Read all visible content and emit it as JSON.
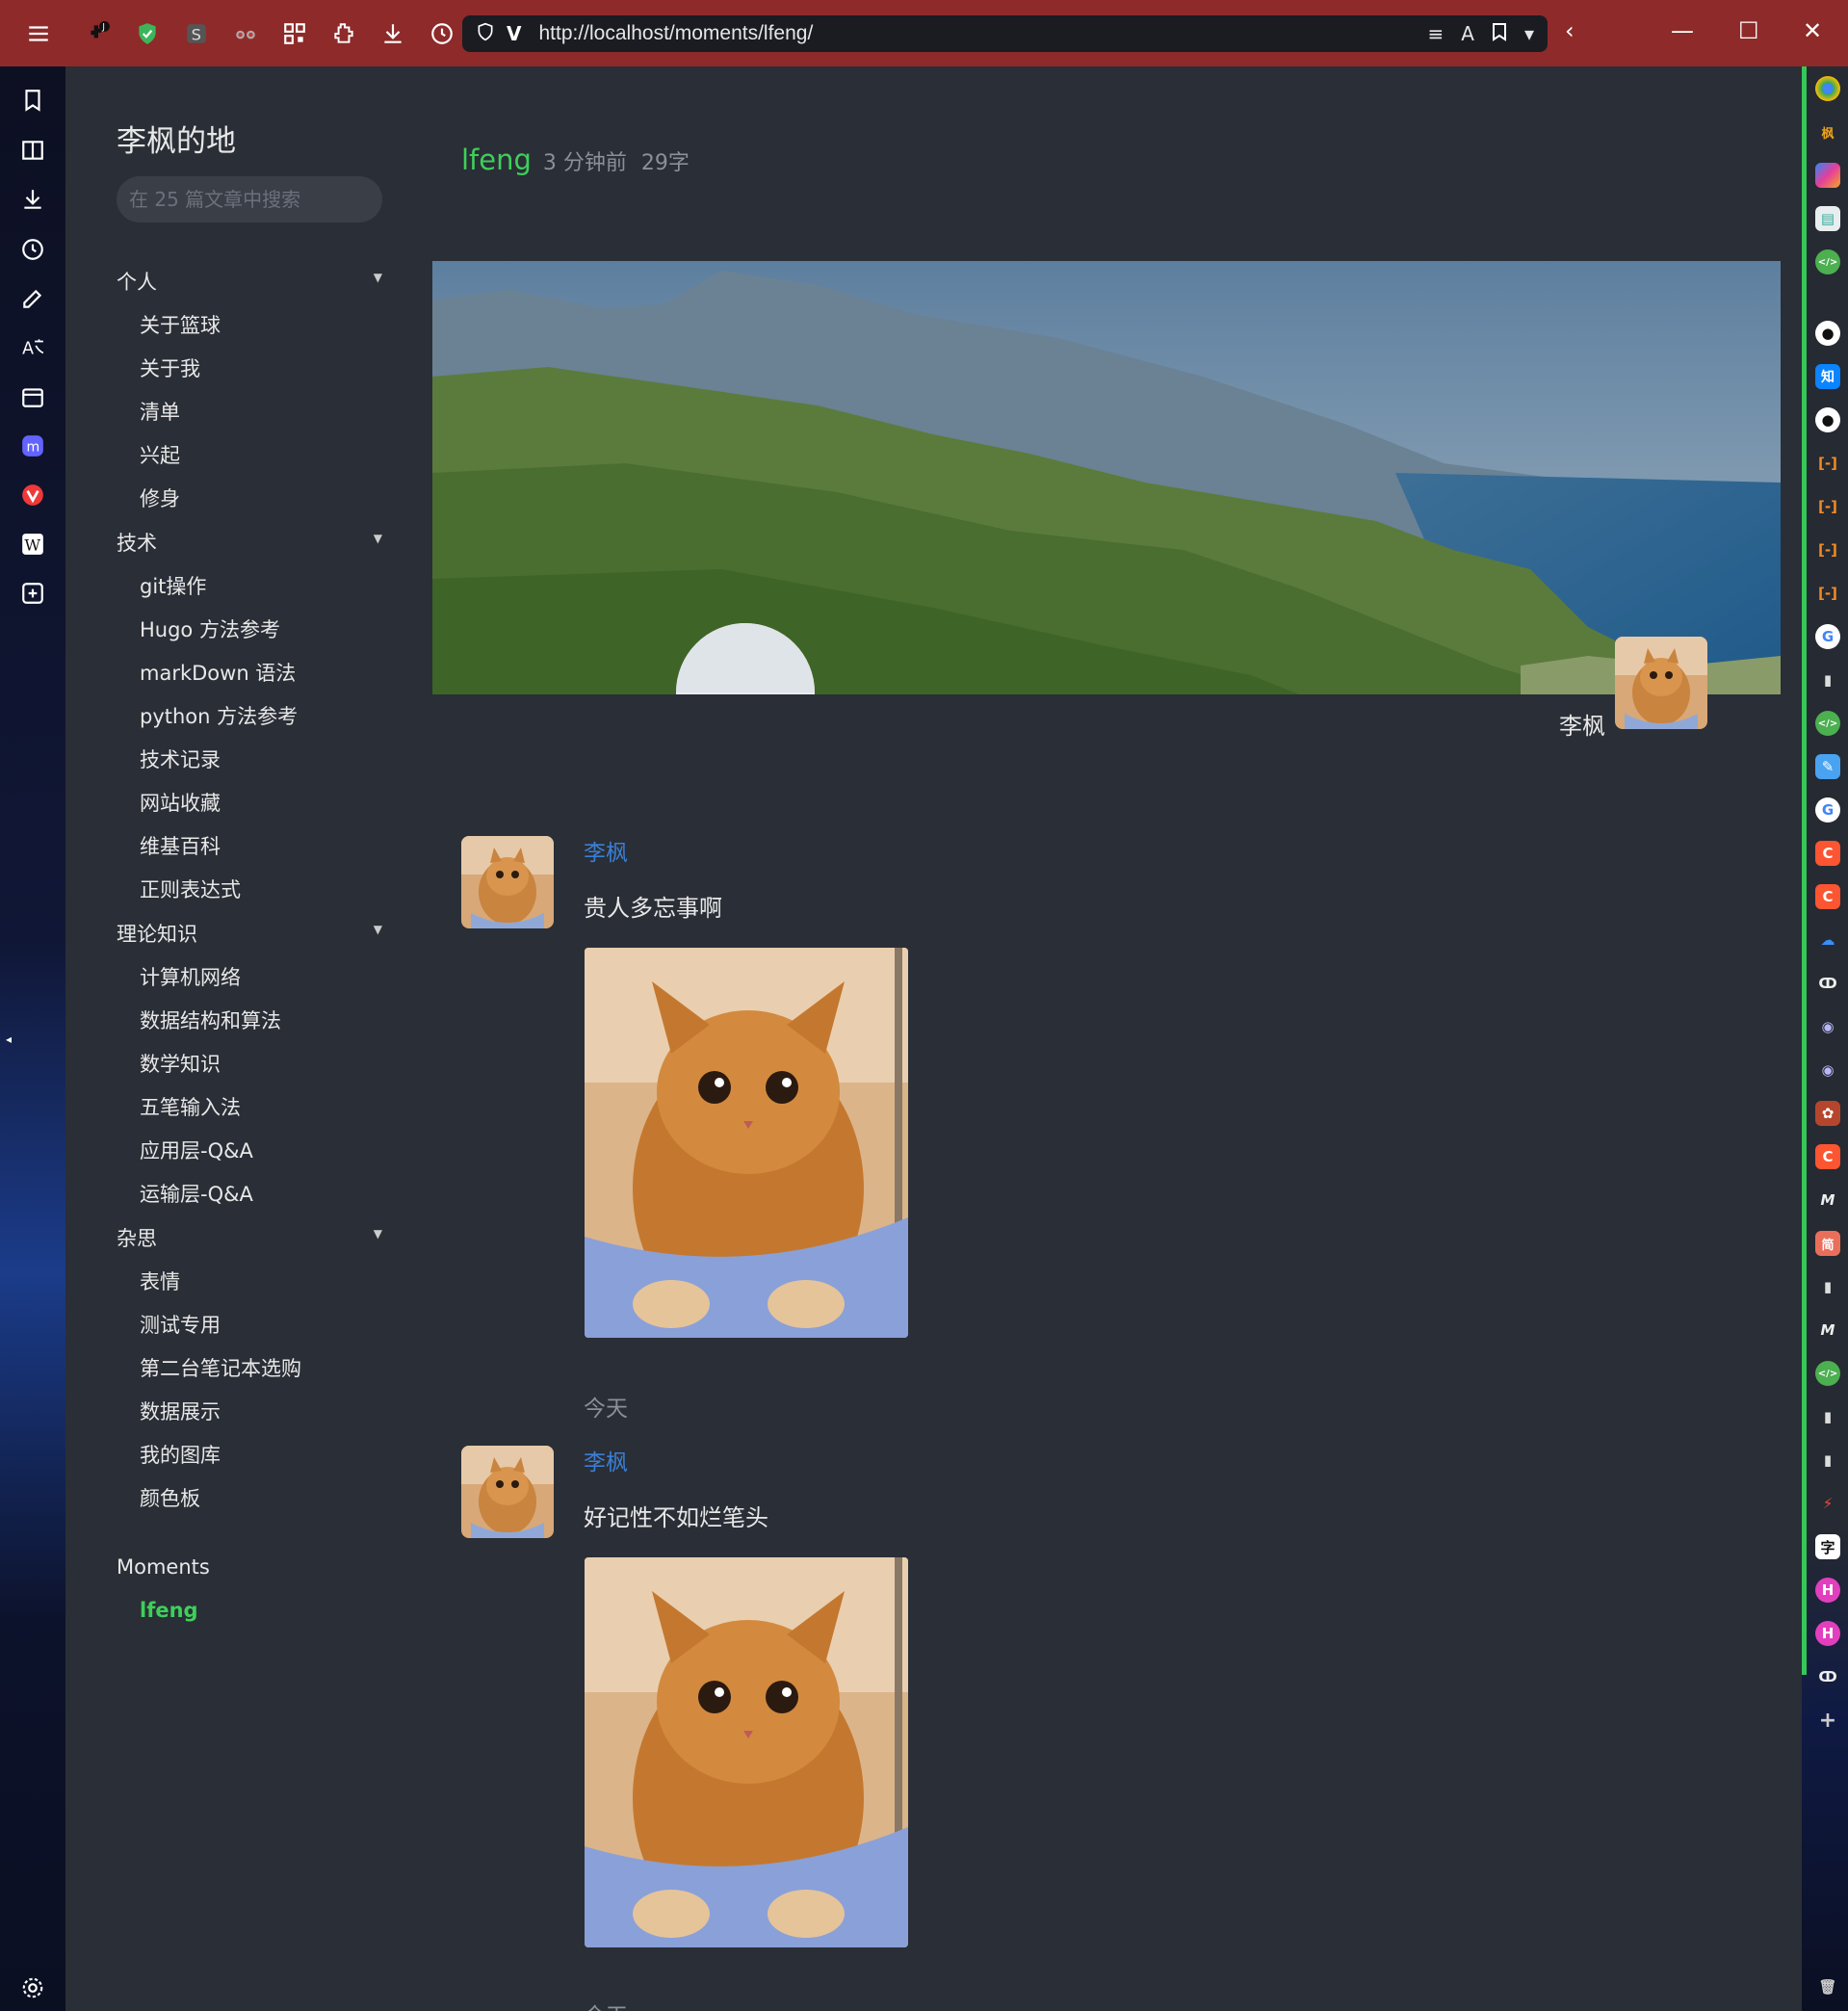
{
  "browser": {
    "url": "http://localhost/moments/lfeng/",
    "theme_color": "#8e2a2a"
  },
  "site": {
    "title": "李枫的地",
    "search_placeholder": "在 25 篇文章中搜索",
    "categories": [
      {
        "label": "个人",
        "items": [
          "关于篮球",
          "关于我",
          "清单",
          "兴起",
          "修身"
        ]
      },
      {
        "label": "技术",
        "items": [
          "git操作",
          "Hugo 方法参考",
          "markDown 语法",
          "python 方法参考",
          "技术记录",
          "网站收藏",
          "维基百科",
          "正则表达式"
        ]
      },
      {
        "label": "理论知识",
        "items": [
          "计算机网络",
          "数据结构和算法",
          "数学知识",
          "五笔输入法",
          "应用层-Q&A",
          "运输层-Q&A"
        ]
      },
      {
        "label": "杂思",
        "items": [
          "表情",
          "测试专用",
          "第二台笔记本选购",
          "数据展示",
          "我的图库",
          "颜色板"
        ]
      }
    ],
    "moments_section": {
      "label": "Moments",
      "active_item": "lfeng"
    },
    "active_color": "#3ecf5a"
  },
  "main": {
    "author": "lfeng",
    "time_ago": "3 分钟前",
    "word_count": "29字",
    "profile_name": "李枫",
    "moments": [
      {
        "name": "李枫",
        "text": "贵人多忘事啊",
        "date": "今天"
      },
      {
        "name": "李枫",
        "text": "好记性不如烂笔头",
        "date": "今天"
      }
    ],
    "link_color": "#3a7fd4"
  }
}
